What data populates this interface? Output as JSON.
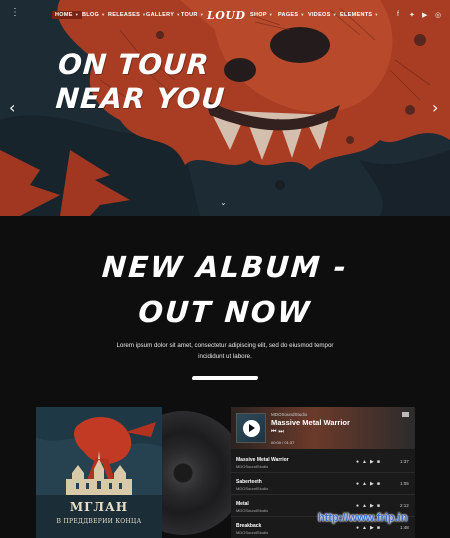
{
  "nav": {
    "items": [
      {
        "label": "HOME",
        "active": true
      },
      {
        "label": "BLOG"
      },
      {
        "label": "RELEASES"
      },
      {
        "label": "GALLERY"
      },
      {
        "label": "TOUR"
      },
      {
        "label": "SHOP"
      },
      {
        "label": "PAGES"
      },
      {
        "label": "VIDEOS"
      },
      {
        "label": "ELEMENTS"
      }
    ],
    "logo": "LOUD",
    "social_icons": [
      "facebook-icon",
      "twitter-icon",
      "youtube-icon",
      "instagram-icon"
    ]
  },
  "hero": {
    "title_line1": "ON TOUR",
    "title_line2": "NEAR YOU",
    "prev_arrow": "‹",
    "next_arrow": "›",
    "scroll_caret": "⌄"
  },
  "album": {
    "title_line1": "NEW ALBUM -",
    "title_line2": "OUT NOW",
    "lede_line1": "Lorem ipsum dolor sit amet, consectetur adipiscing elit, sed do eiusmod tempor",
    "lede_line2": "incididunt ut labore.",
    "cover_title": "МГЛАН",
    "cover_subtitle": "В ПРЕДДВЕРИИ КОНЦА"
  },
  "player": {
    "studio": "MDOSoundStudio",
    "now_playing": "Massive Metal Warrior",
    "time": "00:00 / 01:37",
    "tracks": [
      {
        "name": "Massive Metal Warrior",
        "artist": "MDOSoundStudio",
        "duration": "1:37"
      },
      {
        "name": "Saberteeth",
        "artist": "MDOSoundStudio",
        "duration": "1:05"
      },
      {
        "name": "Metal",
        "artist": "MDOSoundStudio",
        "duration": "2:12"
      },
      {
        "name": "Breakback",
        "artist": "MDOSoundStudio",
        "duration": "1:48"
      }
    ]
  },
  "watermark": "http://www.frip.in",
  "colors": {
    "accent": "#c1462a",
    "background": "#0e0e0f",
    "hero_teal": "#263b47"
  }
}
